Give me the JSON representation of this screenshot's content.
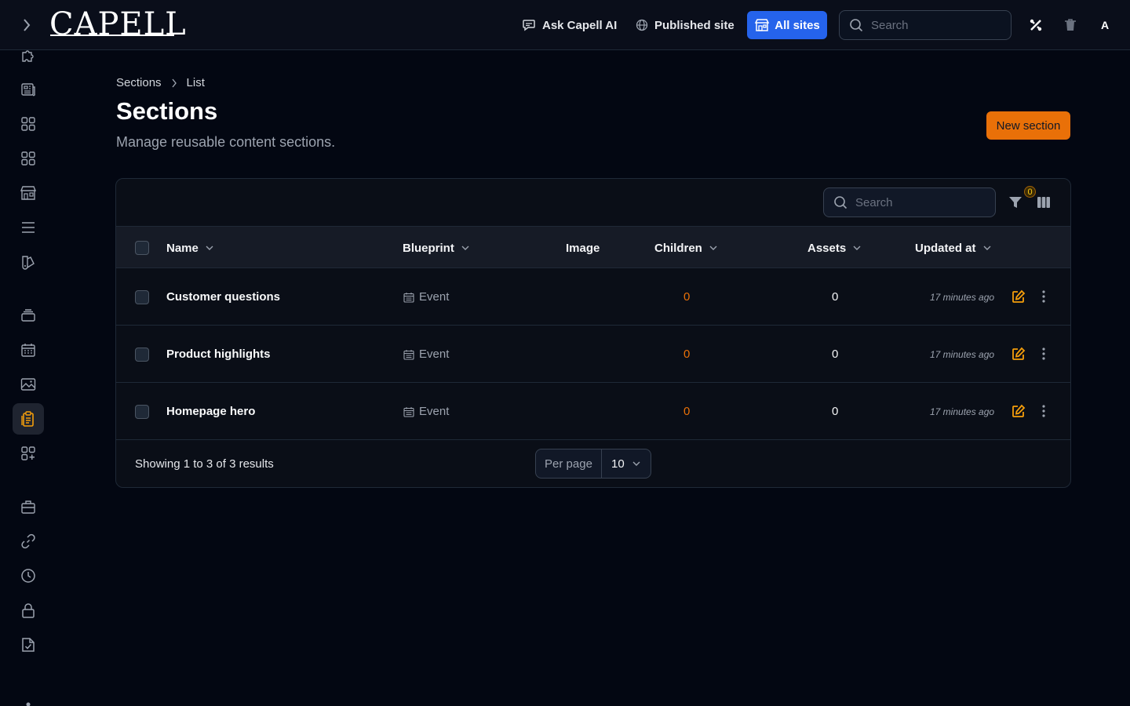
{
  "header": {
    "logo_text": "CAPELL",
    "ask_ai_label": "Ask Capell AI",
    "published_site_label": "Published site",
    "all_sites_label": "All sites",
    "search_placeholder": "Search",
    "avatar_initial": "A"
  },
  "sidebar": {
    "items": [
      {
        "icon": "puzzle-icon"
      },
      {
        "icon": "newspaper-icon"
      },
      {
        "icon": "grid-icon"
      },
      {
        "icon": "grid-icon"
      },
      {
        "icon": "store-icon"
      },
      {
        "icon": "menu-lines-icon"
      },
      {
        "icon": "swatch-icon"
      },
      {
        "icon": "stack-icon"
      },
      {
        "icon": "calendar-icon"
      },
      {
        "icon": "image-icon"
      },
      {
        "icon": "clipboard-icon",
        "active": true
      },
      {
        "icon": "grid-plus-icon"
      },
      {
        "icon": "briefcase-icon"
      },
      {
        "icon": "link-icon"
      },
      {
        "icon": "clock-icon"
      },
      {
        "icon": "lock-icon"
      },
      {
        "icon": "document-check-icon"
      }
    ]
  },
  "breadcrumb": {
    "items": [
      "Sections",
      "List"
    ]
  },
  "page": {
    "title": "Sections",
    "subtitle": "Manage reusable content sections.",
    "new_button_label": "New section"
  },
  "table": {
    "search_placeholder": "Search",
    "filter_count": "0",
    "columns": {
      "name": "Name",
      "blueprint": "Blueprint",
      "image": "Image",
      "children": "Children",
      "assets": "Assets",
      "updated_at": "Updated at"
    },
    "rows": [
      {
        "name": "Customer questions",
        "blueprint": "Event",
        "children": "0",
        "assets": "0",
        "updated_at": "17 minutes ago"
      },
      {
        "name": "Product highlights",
        "blueprint": "Event",
        "children": "0",
        "assets": "0",
        "updated_at": "17 minutes ago"
      },
      {
        "name": "Homepage hero",
        "blueprint": "Event",
        "children": "0",
        "assets": "0",
        "updated_at": "17 minutes ago"
      }
    ],
    "footer_text": "Showing 1 to 3 of 3 results",
    "per_page_label": "Per page",
    "per_page_value": "10"
  },
  "colors": {
    "accent": "#e97008",
    "primary": "#2563eb",
    "background": "#030712"
  }
}
